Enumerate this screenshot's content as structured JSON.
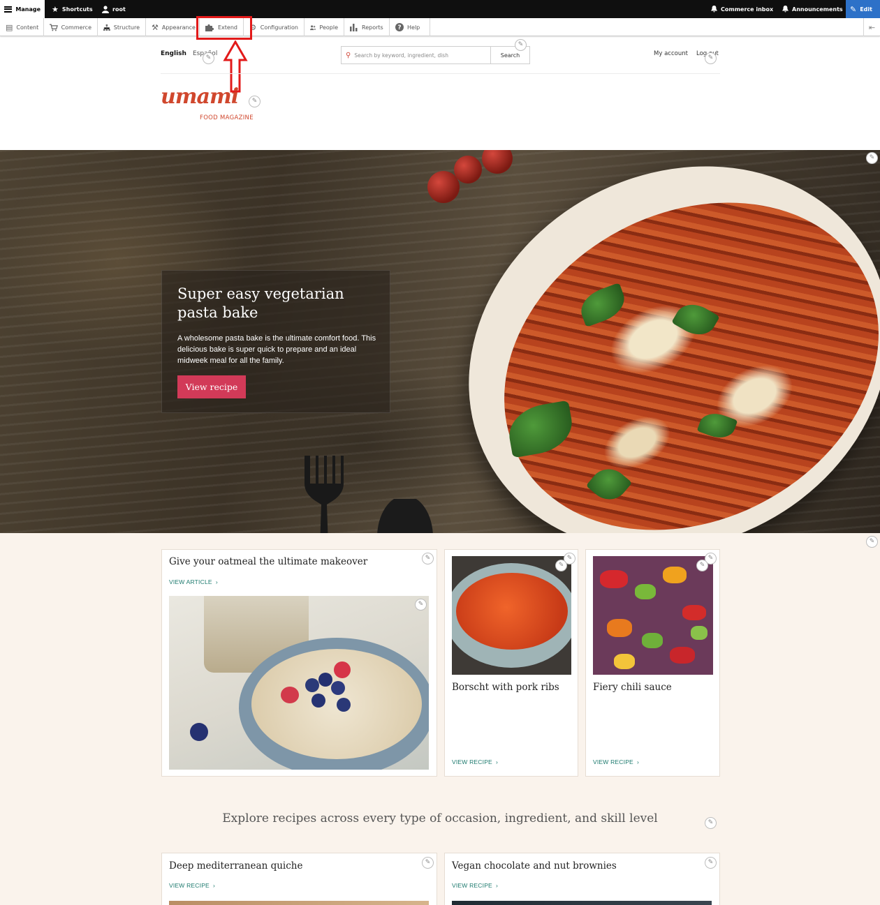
{
  "toolbar": {
    "manage": "Manage",
    "shortcuts": "Shortcuts",
    "user": "root",
    "commerce_inbox": "Commerce inbox",
    "announcements": "Announcements",
    "edit": "Edit"
  },
  "admin_menu": {
    "content": "Content",
    "commerce": "Commerce",
    "structure": "Structure",
    "appearance": "Appearance",
    "extend": "Extend",
    "configuration": "Configuration",
    "people": "People",
    "reports": "Reports",
    "help": "Help"
  },
  "header": {
    "lang_en": "English",
    "lang_es": "Español",
    "search_placeholder": "Search by keyword, ingredient, dish",
    "search_button": "Search",
    "my_account": "My account",
    "log_out": "Log out",
    "logo_word": "umami",
    "logo_sub": "FOOD MAGAZINE"
  },
  "hero": {
    "title": "Super easy vegetarian pasta bake",
    "body": "A wholesome pasta bake is the ultimate comfort food. This delicious bake is super quick to prepare and an ideal midweek meal for all the family.",
    "cta": "View recipe"
  },
  "cards": {
    "oatmeal": {
      "title": "Give your oatmeal the ultimate makeover",
      "link": "VIEW ARTICLE"
    },
    "borscht": {
      "title": "Borscht with pork ribs",
      "link": "VIEW RECIPE"
    },
    "chili": {
      "title": "Fiery chili sauce",
      "link": "VIEW RECIPE"
    },
    "quiche": {
      "title": "Deep mediterranean quiche",
      "link": "VIEW RECIPE"
    },
    "brownies": {
      "title": "Vegan chocolate and nut brownies",
      "link": "VIEW RECIPE"
    }
  },
  "explore": "Explore recipes across every type of occasion, ingredient, and skill level",
  "colors": {
    "brand": "#d0472d",
    "cta": "#d23a58",
    "link": "#1d7a6e",
    "edit_blue": "#2d71c8",
    "annotation": "#e21a1a"
  },
  "icons": [
    "hamburger-icon",
    "star-icon",
    "user-icon",
    "bell-icon",
    "pencil-icon",
    "puzzle-icon",
    "wrench-icon",
    "search-icon",
    "chevron-right-icon"
  ]
}
